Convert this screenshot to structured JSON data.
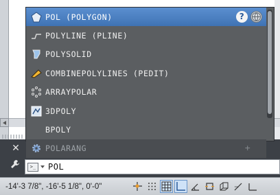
{
  "autocomplete": {
    "items": [
      {
        "label": "POL (POLYGON)",
        "icon": "polygon-icon",
        "selected": true
      },
      {
        "label": "POLYLINE (PLINE)",
        "icon": "polyline-icon"
      },
      {
        "label": "POLYSOLID",
        "icon": "polysolid-icon"
      },
      {
        "label": "COMBINEPOLYLINES (PEDIT)",
        "icon": "pedit-icon"
      },
      {
        "label": "ARRAYPOLAR",
        "icon": "arraypolar-icon"
      },
      {
        "label": "3DPOLY",
        "icon": "3dpoly-icon"
      },
      {
        "label": "BPOLY",
        "icon": ""
      },
      {
        "label": "POLARANG",
        "icon": "gear-icon",
        "dimmed": true
      }
    ],
    "help_icon": "question-icon",
    "web_icon": "globe-icon",
    "add_icon": "+"
  },
  "command_line": {
    "input_text": "POL",
    "close_icon": "✕",
    "customize_icon": "wrench-icon"
  },
  "status_bar": {
    "coordinates": "-14'-3 7/8\", -16'-5 1/8\", 0'-0\"",
    "buttons": [
      "infer-constraints-icon",
      "snap-icon",
      "grid-icon",
      "ortho-icon",
      "polar-icon",
      "osnap-icon",
      "3dosnap-icon",
      "otrack-icon",
      "ducs-icon"
    ],
    "active": [
      "grid-icon",
      "ortho-icon"
    ]
  },
  "colors": {
    "selected": "#4a7fc0",
    "panel": "#3c4046",
    "popup": "#5b5e61"
  }
}
